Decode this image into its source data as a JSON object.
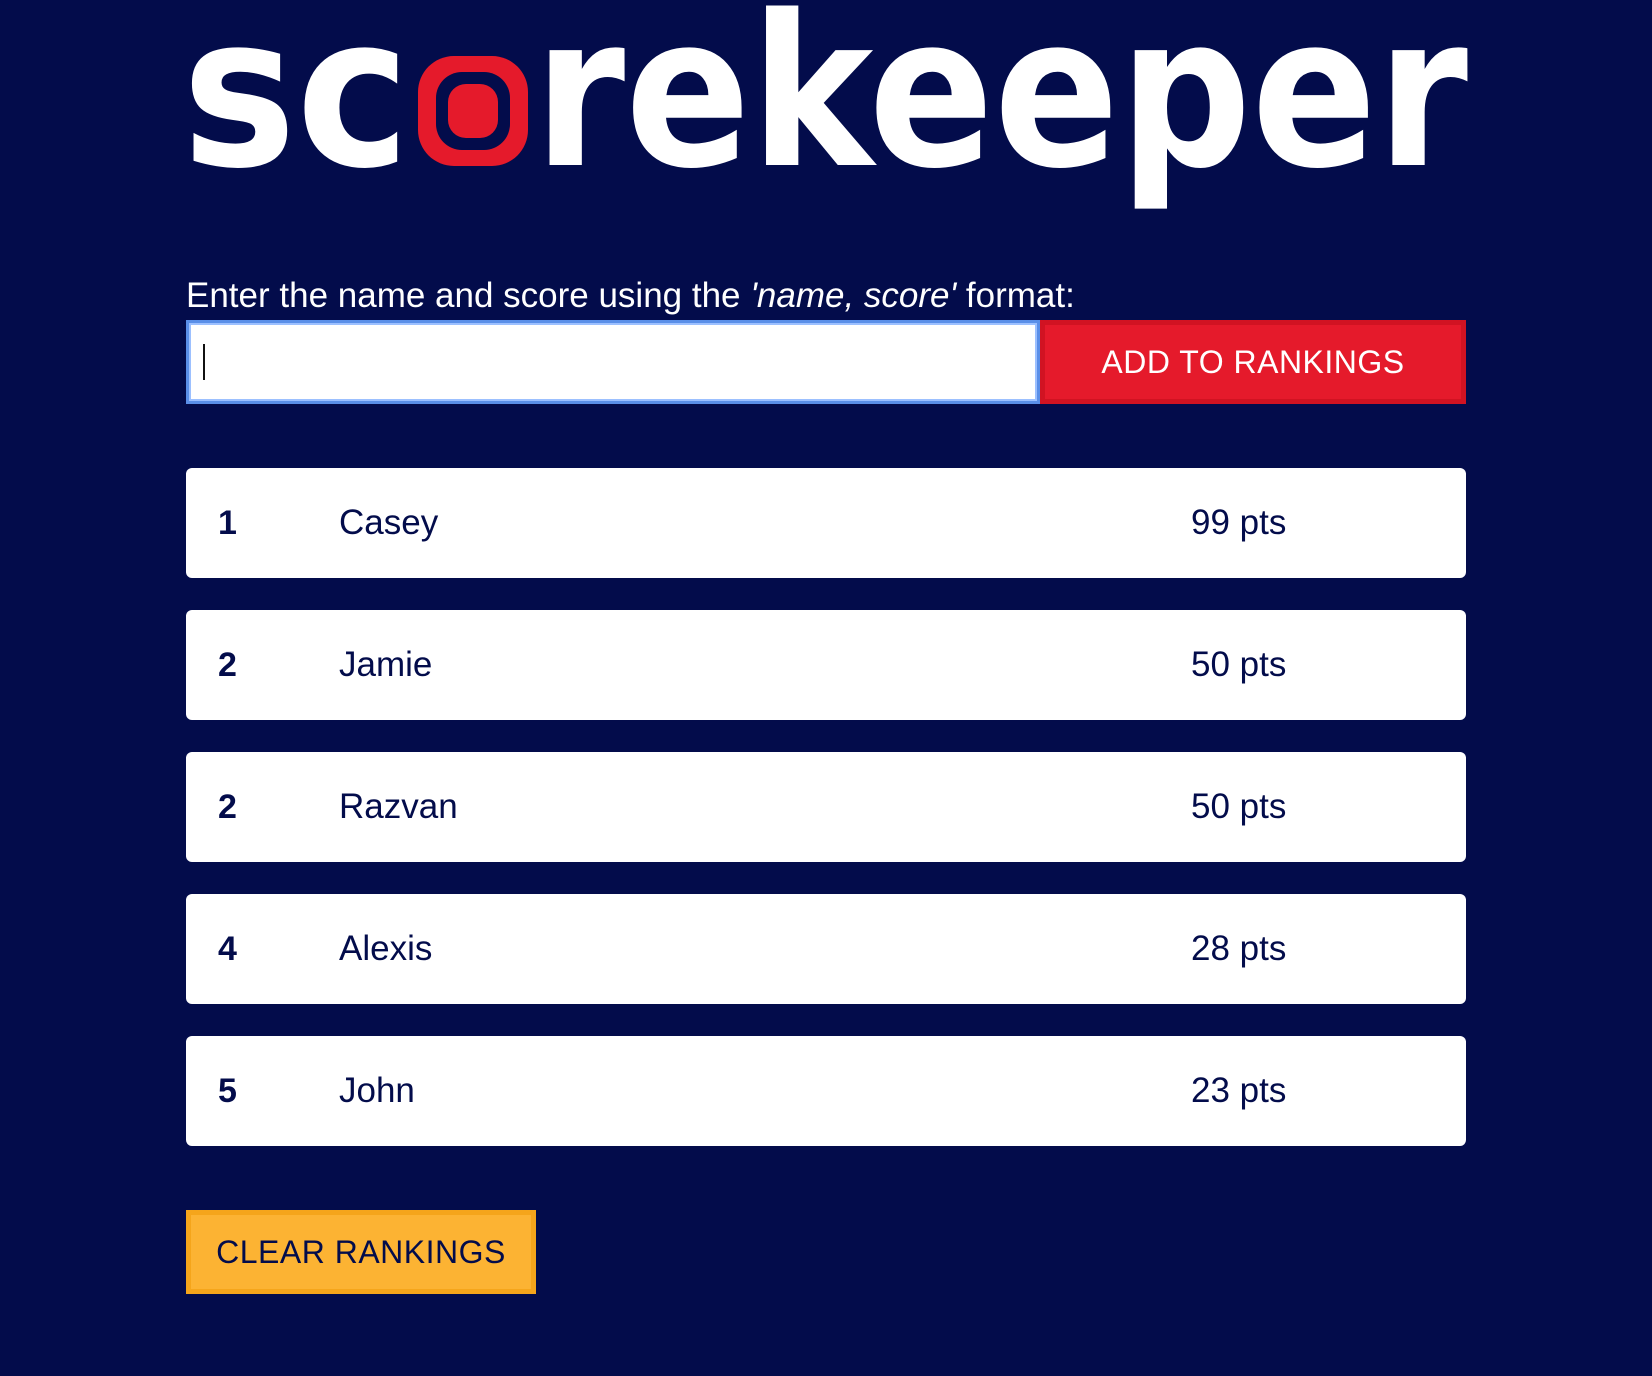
{
  "logo": {
    "text_before": "sc",
    "text_after": "rekeeper",
    "brand_color": "#e51a2b",
    "background_color": "#030c4b"
  },
  "prompt": {
    "lead": "Enter the name and score using the ",
    "format": "'name, score'",
    "tail": " format:"
  },
  "entry": {
    "value": "",
    "add_label": "ADD TO RANKINGS"
  },
  "rankings": [
    {
      "rank": "1",
      "name": "Casey",
      "score": "99 pts"
    },
    {
      "rank": "2",
      "name": "Jamie",
      "score": "50 pts"
    },
    {
      "rank": "2",
      "name": "Razvan",
      "score": "50 pts"
    },
    {
      "rank": "4",
      "name": "Alexis",
      "score": "28 pts"
    },
    {
      "rank": "5",
      "name": "John",
      "score": "23 pts"
    }
  ],
  "clear_label": "CLEAR RANKINGS"
}
